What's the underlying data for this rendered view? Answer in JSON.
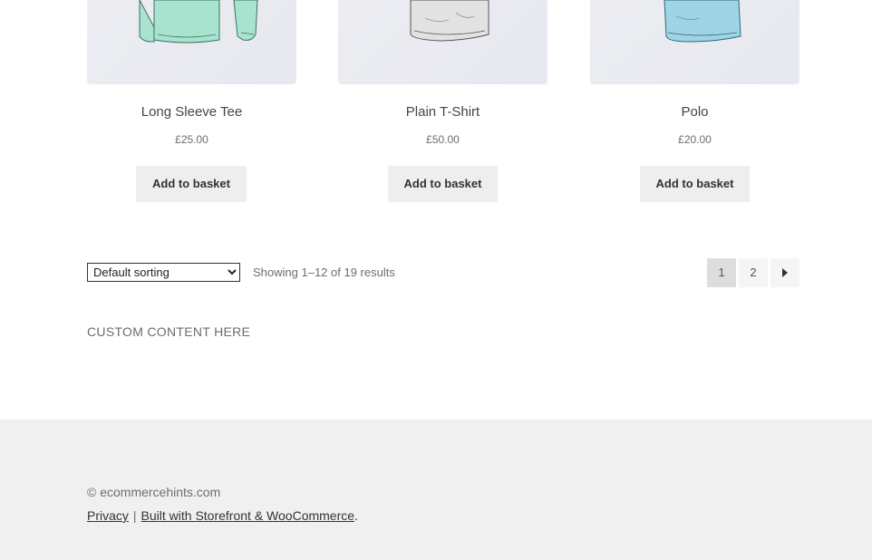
{
  "products": [
    {
      "title": "Long Sleeve Tee",
      "price": "£25.00",
      "button": "Add to basket",
      "image_color": "#a7e3cf",
      "image_icon": "long-sleeve-tee-image"
    },
    {
      "title": "Plain T-Shirt",
      "price": "£50.00",
      "button": "Add to basket",
      "image_color": "#dadada",
      "image_icon": "plain-tshirt-image"
    },
    {
      "title": "Polo",
      "price": "£20.00",
      "button": "Add to basket",
      "image_color": "#9fd4e6",
      "image_icon": "polo-image"
    }
  ],
  "toolbar": {
    "sort_options": [
      "Default sorting"
    ],
    "sort_selected": "Default sorting",
    "result_count": "Showing 1–12 of 19 results"
  },
  "pagination": {
    "pages": [
      "1",
      "2"
    ],
    "current": "1",
    "next_icon": "chevron-right-icon"
  },
  "custom_content": "CUSTOM CONTENT HERE",
  "footer": {
    "copyright": "© ecommercehints.com",
    "privacy_link": "Privacy",
    "separator": "|",
    "built_with_link": "Built with Storefront & WooCommerce",
    "trailing": "."
  }
}
